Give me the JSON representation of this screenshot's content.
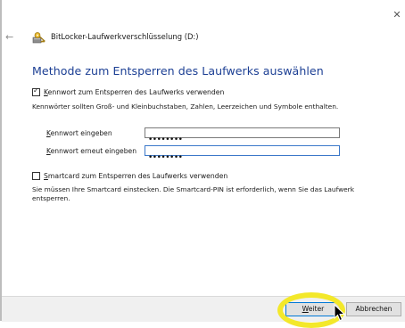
{
  "window": {
    "title": "BitLocker-Laufwerkverschlüsselung (D:)",
    "close_glyph": "✕",
    "back_glyph": "←"
  },
  "heading": "Methode zum Entsperren des Laufwerks auswählen",
  "password_option": {
    "checked": true,
    "label_first": "K",
    "label_rest": "ennwort zum Entsperren des Laufwerks verwenden",
    "help": "Kennwörter sollten Groß- und Kleinbuchstaben, Zahlen, Leerzeichen und Symbole enthalten.",
    "enter_label_first": "K",
    "enter_label_rest": "ennwort eingeben",
    "enter_value": "••••••••",
    "reenter_label_first": "K",
    "reenter_label_rest": "ennwort erneut eingeben",
    "reenter_value": "••••••••"
  },
  "smartcard_option": {
    "checked": false,
    "label_first": "S",
    "label_rest": "martcard zum Entsperren des Laufwerks verwenden",
    "help_line1": "Sie müssen Ihre Smartcard einstecken. Die Smartcard-PIN ist erforderlich, wenn Sie das Laufwerk",
    "help_line2": "entsperren."
  },
  "buttons": {
    "next_first": "W",
    "next_rest": "eiter",
    "cancel": "Abbrechen"
  },
  "colors": {
    "heading": "#1c3f94",
    "highlight": "#f3e82a",
    "active_border": "#3b78c9"
  },
  "icons": {
    "title": "bitlocker-key-icon",
    "cursor": "mouse-pointer-icon"
  }
}
